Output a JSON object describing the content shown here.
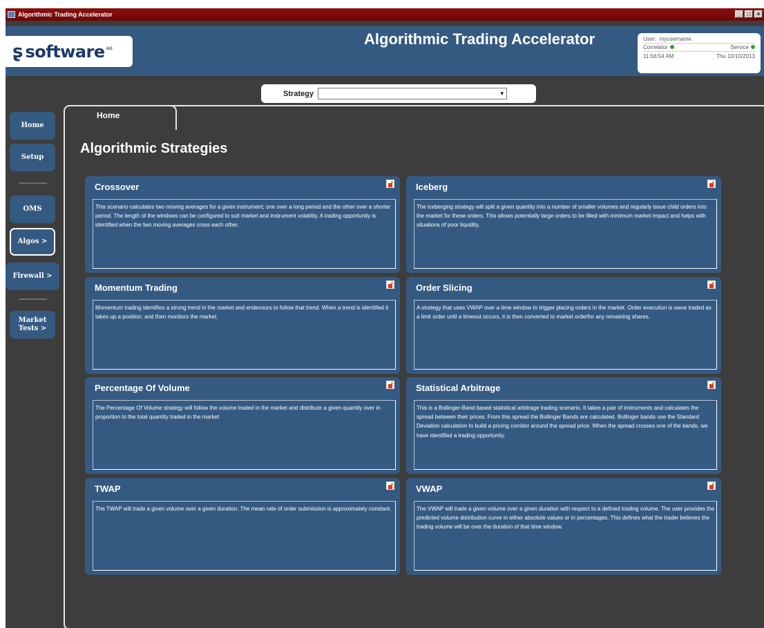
{
  "window": {
    "title": "Algorithmic Trading Accelerator"
  },
  "header": {
    "logo_text": "software",
    "logo_suffix": "AG",
    "app_title": "Algorithmic Trading Accelerator",
    "user_label": "User:",
    "user_name": "myusername",
    "correlator_label": "Correlator",
    "service_label": "Service",
    "time": "11:56:54 AM",
    "date": "Thu 10/10/2013",
    "status_color": "#2fa12f"
  },
  "strategy": {
    "label": "Strategy",
    "value": ""
  },
  "nav": {
    "home": "Home",
    "setup": "Setup",
    "oms": "OMS",
    "algos": "Algos >",
    "firewall": "Firewall >",
    "market_tests": "Market Tests >"
  },
  "tab": {
    "label": "Home"
  },
  "page_title": "Algorithmic Strategies",
  "cards": [
    {
      "title": "Crossover",
      "text": "This scenario calculates two moving averages for a given instrument; one over a long period and the other over a shorter period. The length of the windows can be configured to suit market and instrument volatility. A trading opportunity is identified when the two moving averages cross each other."
    },
    {
      "title": "Iceberg",
      "text": "The iceberging strategy will split a given quantity into a number of smaller volumes and regularly issue child orders into the market for these orders. This allows potentially large orders to be filled with minimum market impact and helps with situations of poor liquidity."
    },
    {
      "title": "Momentum Trading",
      "text": "Momentum trading identifies a strong trend in the market and endevours to follow that trend. When a trend is identified it takes up a position; and then monitors the market."
    },
    {
      "title": "Order Slicing",
      "text": "A strategy that uses VWAP over a time window to trigger placing orders in the market. Order execution is wave traded as a limit order until a timeout occurs, it is then converted to market orderfor any remaining shares."
    },
    {
      "title": "Percentage Of Volume",
      "text": "The Percentage Of Volume strategy will follow the volume traded in the market and distribute a given quantity over in proportion to the total quantity traded in the market"
    },
    {
      "title": "Statistical Arbitrage",
      "text": "This is a Bollinger-Band based statistical arbitrage trading scenario. It takes a pair of instruments and calculates the spread between their prices. From this spread the Bollinger Bands are calculated. Bollinger bands use the Standard Deviation calculation to build a pricing corridor around the spread price. When the spread crosses one of the bands, we have identified a trading opportunity."
    },
    {
      "title": "TWAP",
      "text": "The TWAP will trade a given volume over a given duration.  The mean rate of order submission is approximately constant."
    },
    {
      "title": "VWAP",
      "text": "The VWAP will trade a given volume over a given duration with respect to a defined trading volume. The user provides the predicted volume distribution curve in either absolute values or in percentages. This defines what the trader believes the trading volume will be over the duration of that time window."
    }
  ]
}
